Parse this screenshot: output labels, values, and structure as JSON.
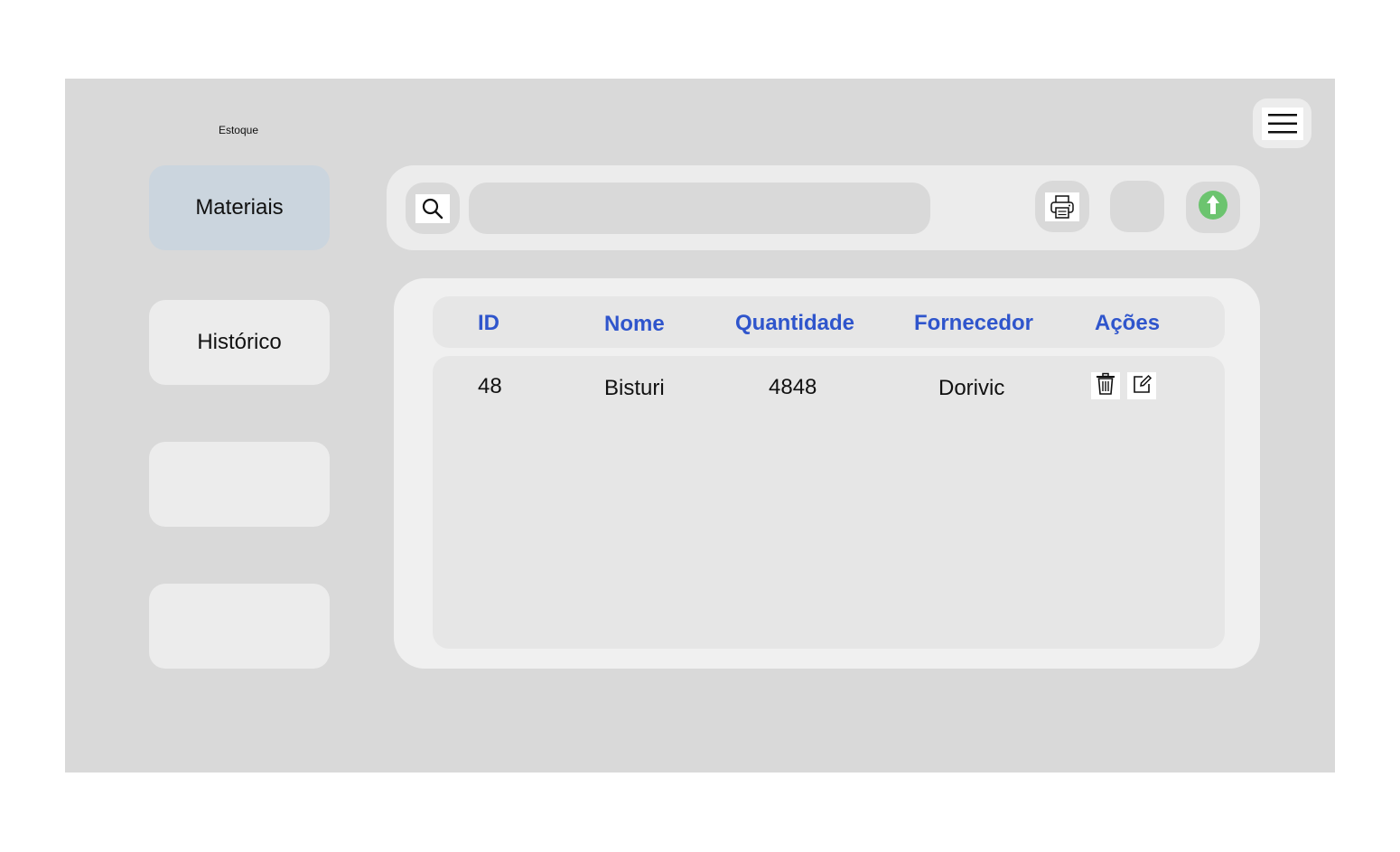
{
  "header": {
    "app_title": "Estoque",
    "menu_icon": "hamburger-menu-icon"
  },
  "sidebar": {
    "items": [
      {
        "label": "Materiais",
        "active": true
      },
      {
        "label": "Histórico",
        "active": false
      },
      {
        "label": "",
        "active": false
      },
      {
        "label": "",
        "active": false
      }
    ]
  },
  "toolbar": {
    "search_icon": "search-icon",
    "search_value": "",
    "print_icon": "printer-icon",
    "upload_icon": "upload-arrow-icon",
    "upload_color": "#6cc46f"
  },
  "table": {
    "columns": [
      "ID",
      "Nome",
      "Quantidade",
      "Fornecedor",
      "Ações"
    ],
    "header_color": "#2f55cc",
    "rows": [
      {
        "id": "48",
        "nome": "Bisturi",
        "quantidade": "4848",
        "fornecedor": "Dorivic"
      }
    ],
    "row_actions": [
      "trash-icon",
      "edit-icon"
    ]
  }
}
